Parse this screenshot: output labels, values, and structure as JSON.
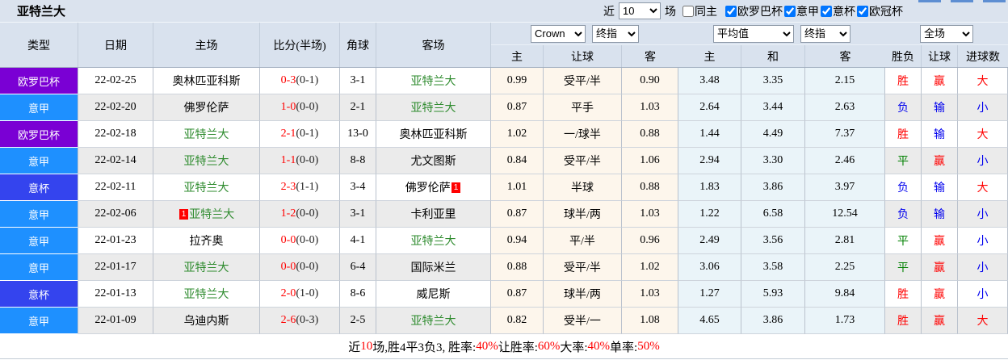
{
  "title": "亚特兰大",
  "controls": {
    "recent_label": "近",
    "recent_count": "10",
    "games_label": "场",
    "same_home": {
      "label": "同主",
      "checked": false
    },
    "filters": [
      {
        "label": "欧罗巴杯",
        "checked": true
      },
      {
        "label": "意甲",
        "checked": true
      },
      {
        "label": "意杯",
        "checked": true
      },
      {
        "label": "欧冠杯",
        "checked": true
      }
    ]
  },
  "header": {
    "left_cols": [
      "类型",
      "日期",
      "主场",
      "比分(半场)",
      "角球",
      "客场"
    ],
    "selects": {
      "bookmaker": "Crown",
      "bookmaker_mode": "终指",
      "euro_source": "平均值",
      "euro_mode": "终指",
      "scope": "全场"
    },
    "crown_cols": [
      "主",
      "让球",
      "客"
    ],
    "euro_cols": [
      "主",
      "和",
      "客"
    ],
    "result_cols": [
      "胜负",
      "让球",
      "进球数"
    ]
  },
  "misc": {
    "red_card_badge": "1"
  },
  "colors": {
    "europa_league": "#7a00d4",
    "serie_a": "#1e90ff",
    "coppa_italia": "#3444ee",
    "red": "#ff0000",
    "blue": "#0000ee",
    "green": "#008000",
    "team_green": "#2e8b2e",
    "header_bg": "#d9e2ee",
    "crown_col_bg": "#fdf6ec",
    "euro_col_bg": "#eaf4f9",
    "alt_row_bg": "#ebebeb",
    "tab_stub": "#5d8ed2"
  },
  "rows": [
    {
      "type": "欧罗巴杯",
      "type_key": "europa_league",
      "date": "22-02-25",
      "home": "奥林匹亚科斯",
      "home_is_focus": false,
      "home_red_card": false,
      "score": "0-3",
      "half_score": "(0-1)",
      "corner": "3-1",
      "away": "亚特兰大",
      "away_is_focus": true,
      "away_red_card": false,
      "crown_odds": [
        "0.99",
        "受平/半",
        "0.90"
      ],
      "euro_odds": [
        "3.48",
        "3.35",
        "2.15"
      ],
      "results": [
        {
          "text": "胜",
          "color": "red"
        },
        {
          "text": "赢",
          "color": "red"
        },
        {
          "text": "大",
          "color": "red"
        }
      ]
    },
    {
      "type": "意甲",
      "type_key": "serie_a",
      "date": "22-02-20",
      "home": "佛罗伦萨",
      "home_is_focus": false,
      "home_red_card": false,
      "score": "1-0",
      "half_score": "(0-0)",
      "corner": "2-1",
      "away": "亚特兰大",
      "away_is_focus": true,
      "away_red_card": false,
      "crown_odds": [
        "0.87",
        "平手",
        "1.03"
      ],
      "euro_odds": [
        "2.64",
        "3.44",
        "2.63"
      ],
      "results": [
        {
          "text": "负",
          "color": "blue"
        },
        {
          "text": "输",
          "color": "blue"
        },
        {
          "text": "小",
          "color": "blue"
        }
      ]
    },
    {
      "type": "欧罗巴杯",
      "type_key": "europa_league",
      "date": "22-02-18",
      "home": "亚特兰大",
      "home_is_focus": true,
      "home_red_card": false,
      "score": "2-1",
      "half_score": "(0-1)",
      "corner": "13-0",
      "away": "奥林匹亚科斯",
      "away_is_focus": false,
      "away_red_card": false,
      "crown_odds": [
        "1.02",
        "一/球半",
        "0.88"
      ],
      "euro_odds": [
        "1.44",
        "4.49",
        "7.37"
      ],
      "results": [
        {
          "text": "胜",
          "color": "red"
        },
        {
          "text": "输",
          "color": "blue"
        },
        {
          "text": "大",
          "color": "red"
        }
      ]
    },
    {
      "type": "意甲",
      "type_key": "serie_a",
      "date": "22-02-14",
      "home": "亚特兰大",
      "home_is_focus": true,
      "home_red_card": false,
      "score": "1-1",
      "half_score": "(0-0)",
      "corner": "8-8",
      "away": "尤文图斯",
      "away_is_focus": false,
      "away_red_card": false,
      "crown_odds": [
        "0.84",
        "受平/半",
        "1.06"
      ],
      "euro_odds": [
        "2.94",
        "3.30",
        "2.46"
      ],
      "results": [
        {
          "text": "平",
          "color": "green"
        },
        {
          "text": "赢",
          "color": "red"
        },
        {
          "text": "小",
          "color": "blue"
        }
      ]
    },
    {
      "type": "意杯",
      "type_key": "coppa_italia",
      "date": "22-02-11",
      "home": "亚特兰大",
      "home_is_focus": true,
      "home_red_card": false,
      "score": "2-3",
      "half_score": "(1-1)",
      "corner": "3-4",
      "away": "佛罗伦萨",
      "away_is_focus": false,
      "away_red_card": true,
      "crown_odds": [
        "1.01",
        "半球",
        "0.88"
      ],
      "euro_odds": [
        "1.83",
        "3.86",
        "3.97"
      ],
      "results": [
        {
          "text": "负",
          "color": "blue"
        },
        {
          "text": "输",
          "color": "blue"
        },
        {
          "text": "大",
          "color": "red"
        }
      ]
    },
    {
      "type": "意甲",
      "type_key": "serie_a",
      "date": "22-02-06",
      "home": "亚特兰大",
      "home_is_focus": true,
      "home_red_card": true,
      "score": "1-2",
      "half_score": "(0-0)",
      "corner": "3-1",
      "away": "卡利亚里",
      "away_is_focus": false,
      "away_red_card": false,
      "crown_odds": [
        "0.87",
        "球半/两",
        "1.03"
      ],
      "euro_odds": [
        "1.22",
        "6.58",
        "12.54"
      ],
      "results": [
        {
          "text": "负",
          "color": "blue"
        },
        {
          "text": "输",
          "color": "blue"
        },
        {
          "text": "小",
          "color": "blue"
        }
      ]
    },
    {
      "type": "意甲",
      "type_key": "serie_a",
      "date": "22-01-23",
      "home": "拉齐奥",
      "home_is_focus": false,
      "home_red_card": false,
      "score": "0-0",
      "half_score": "(0-0)",
      "corner": "4-1",
      "away": "亚特兰大",
      "away_is_focus": true,
      "away_red_card": false,
      "crown_odds": [
        "0.94",
        "平/半",
        "0.96"
      ],
      "euro_odds": [
        "2.49",
        "3.56",
        "2.81"
      ],
      "results": [
        {
          "text": "平",
          "color": "green"
        },
        {
          "text": "赢",
          "color": "red"
        },
        {
          "text": "小",
          "color": "blue"
        }
      ]
    },
    {
      "type": "意甲",
      "type_key": "serie_a",
      "date": "22-01-17",
      "home": "亚特兰大",
      "home_is_focus": true,
      "home_red_card": false,
      "score": "0-0",
      "half_score": "(0-0)",
      "corner": "6-4",
      "away": "国际米兰",
      "away_is_focus": false,
      "away_red_card": false,
      "crown_odds": [
        "0.88",
        "受平/半",
        "1.02"
      ],
      "euro_odds": [
        "3.06",
        "3.58",
        "2.25"
      ],
      "results": [
        {
          "text": "平",
          "color": "green"
        },
        {
          "text": "赢",
          "color": "red"
        },
        {
          "text": "小",
          "color": "blue"
        }
      ]
    },
    {
      "type": "意杯",
      "type_key": "coppa_italia",
      "date": "22-01-13",
      "home": "亚特兰大",
      "home_is_focus": true,
      "home_red_card": false,
      "score": "2-0",
      "half_score": "(1-0)",
      "corner": "8-6",
      "away": "威尼斯",
      "away_is_focus": false,
      "away_red_card": false,
      "crown_odds": [
        "0.87",
        "球半/两",
        "1.03"
      ],
      "euro_odds": [
        "1.27",
        "5.93",
        "9.84"
      ],
      "results": [
        {
          "text": "胜",
          "color": "red"
        },
        {
          "text": "赢",
          "color": "red"
        },
        {
          "text": "小",
          "color": "blue"
        }
      ]
    },
    {
      "type": "意甲",
      "type_key": "serie_a",
      "date": "22-01-09",
      "home": "乌迪内斯",
      "home_is_focus": false,
      "home_red_card": false,
      "score": "2-6",
      "half_score": "(0-3)",
      "corner": "2-5",
      "away": "亚特兰大",
      "away_is_focus": true,
      "away_red_card": false,
      "crown_odds": [
        "0.82",
        "受半/一",
        "1.08"
      ],
      "euro_odds": [
        "4.65",
        "3.86",
        "1.73"
      ],
      "results": [
        {
          "text": "胜",
          "color": "red"
        },
        {
          "text": "赢",
          "color": "red"
        },
        {
          "text": "大",
          "color": "red"
        }
      ]
    }
  ],
  "footer": {
    "segments": [
      {
        "text": "近",
        "red": false
      },
      {
        "text": "10",
        "red": true
      },
      {
        "text": "场,胜4平3负3, 胜率:",
        "red": false
      },
      {
        "text": "40%",
        "red": true
      },
      {
        "text": " 让胜率:",
        "red": false
      },
      {
        "text": "60%",
        "red": true
      },
      {
        "text": " 大率:",
        "red": false
      },
      {
        "text": "40%",
        "red": true
      },
      {
        "text": " 单率:",
        "red": false
      },
      {
        "text": "50%",
        "red": true
      }
    ]
  }
}
